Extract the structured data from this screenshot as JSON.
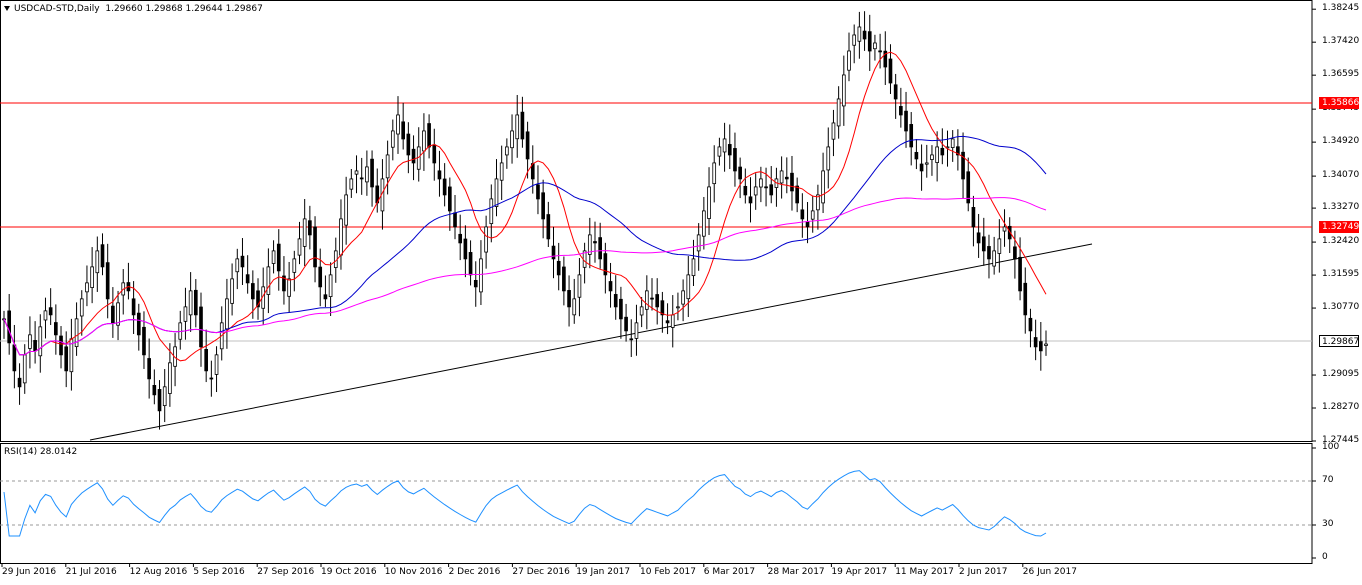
{
  "header": {
    "symbol": "USDCAD-STD,Daily",
    "ohlc": "1.29660 1.29868 1.29644 1.29867"
  },
  "rsi": {
    "label": "RSI(14) 28.0142",
    "ticks": [
      "100",
      "70",
      "30",
      "0"
    ],
    "levels": [
      70,
      30
    ],
    "color": "#1e90ff"
  },
  "price_axis": {
    "ticks": [
      "1.38245",
      "1.37420",
      "1.36595",
      "1.35745",
      "1.34920",
      "1.34070",
      "1.33270",
      "1.32420",
      "1.31595",
      "1.30770",
      "1.29095",
      "1.28270",
      "1.27445"
    ],
    "tick_values": [
      1.38245,
      1.3742,
      1.36595,
      1.35745,
      1.3492,
      1.3407,
      1.3327,
      1.3242,
      1.31595,
      1.3077,
      1.29095,
      1.2827,
      1.27445
    ],
    "level_1": "1.35866",
    "level_2": "1.32749",
    "current": "1.29867"
  },
  "date_axis": {
    "ticks": [
      "29 Jun 2016",
      "21 Jul 2016",
      "12 Aug 2016",
      "5 Sep 2016",
      "27 Sep 2016",
      "19 Oct 2016",
      "10 Nov 2016",
      "2 Dec 2016",
      "27 Dec 2016",
      "19 Jan 2017",
      "10 Feb 2017",
      "6 Mar 2017",
      "28 Mar 2017",
      "19 Apr 2017",
      "11 May 2017",
      "2 Jun 2017",
      "26 Jun 2017"
    ]
  },
  "colors": {
    "level_line": "#ff0000",
    "ma_fast": "#ff0000",
    "ma_mid": "#0000cc",
    "ma_slow": "#ff00ff",
    "trendline": "#000000",
    "candle": "#000000"
  },
  "chart_data": {
    "type": "candlestick",
    "title": "USDCAD-STD,Daily",
    "ylim": [
      1.27445,
      1.3845
    ],
    "horizontal_levels": [
      1.35866,
      1.32749,
      1.29867
    ],
    "close_series_approx": [
      1.305,
      1.299,
      1.292,
      1.288,
      1.296,
      1.301,
      1.297,
      1.303,
      1.307,
      1.306,
      1.301,
      1.296,
      1.292,
      1.3,
      1.305,
      1.31,
      1.314,
      1.318,
      1.322,
      1.318,
      1.31,
      1.304,
      1.309,
      1.314,
      1.312,
      1.306,
      1.301,
      1.296,
      1.29,
      1.286,
      1.282,
      1.288,
      1.294,
      1.298,
      1.304,
      1.308,
      1.312,
      1.306,
      1.298,
      1.292,
      1.29,
      1.296,
      1.304,
      1.31,
      1.315,
      1.32,
      1.318,
      1.314,
      1.31,
      1.308,
      1.313,
      1.318,
      1.322,
      1.317,
      1.312,
      1.315,
      1.32,
      1.325,
      1.33,
      1.326,
      1.318,
      1.313,
      1.31,
      1.316,
      1.322,
      1.33,
      1.336,
      1.34,
      1.342,
      1.34,
      1.343,
      1.338,
      1.334,
      1.34,
      1.346,
      1.352,
      1.356,
      1.35,
      1.346,
      1.344,
      1.348,
      1.352,
      1.348,
      1.344,
      1.34,
      1.336,
      1.332,
      1.328,
      1.324,
      1.32,
      1.316,
      1.313,
      1.32,
      1.328,
      1.335,
      1.34,
      1.344,
      1.348,
      1.352,
      1.356,
      1.35,
      1.345,
      1.34,
      1.335,
      1.33,
      1.325,
      1.32,
      1.316,
      1.312,
      1.308,
      1.31,
      1.316,
      1.322,
      1.326,
      1.324,
      1.32,
      1.316,
      1.312,
      1.308,
      1.305,
      1.302,
      1.3,
      1.304,
      1.308,
      1.312,
      1.31,
      1.308,
      1.306,
      1.304,
      1.306,
      1.308,
      1.312,
      1.316,
      1.32,
      1.326,
      1.332,
      1.338,
      1.344,
      1.348,
      1.35,
      1.346,
      1.342,
      1.34,
      1.336,
      1.334,
      1.338,
      1.34,
      1.338,
      1.336,
      1.34,
      1.342,
      1.34,
      1.337,
      1.334,
      1.33,
      1.328,
      1.332,
      1.336,
      1.342,
      1.348,
      1.354,
      1.36,
      1.366,
      1.372,
      1.376,
      1.378,
      1.375,
      1.372,
      1.374,
      1.372,
      1.368,
      1.364,
      1.36,
      1.356,
      1.352,
      1.348,
      1.345,
      1.342,
      1.344,
      1.346,
      1.348,
      1.346,
      1.348,
      1.35,
      1.346,
      1.34,
      1.334,
      1.328,
      1.324,
      1.322,
      1.32,
      1.322,
      1.325,
      1.328,
      1.325,
      1.32,
      1.312,
      1.306,
      1.302,
      1.298,
      1.297,
      1.2987
    ]
  }
}
